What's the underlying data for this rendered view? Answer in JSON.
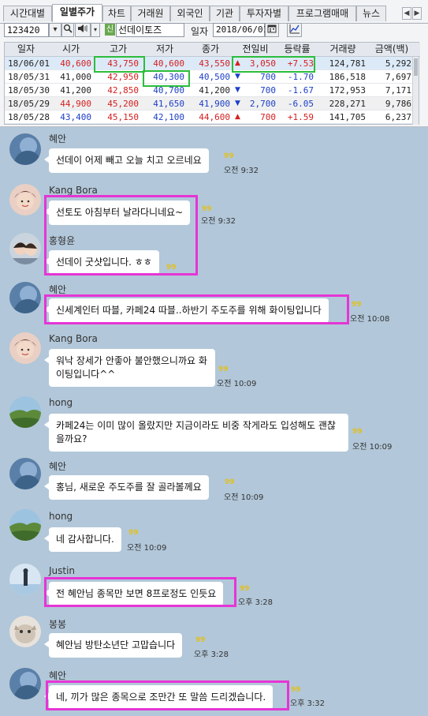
{
  "tabs": [
    "시간대별",
    "일별주가",
    "차트",
    "거래원",
    "외국인",
    "기관",
    "투자자별",
    "프로그램매매",
    "뉴스"
  ],
  "active_tab": "일별주가",
  "tab_arrows": [
    "◀",
    "▶"
  ],
  "toolbar": {
    "code": "123420",
    "dropdown_icon": "chevron-down-icon",
    "search_icon": "search-icon",
    "speaker_icon": "speaker-icon",
    "badge": "신",
    "stock_name": "선데이토즈",
    "date_label": "일자",
    "date_value": "2018/06/01",
    "calendar_icon": "calendar-icon",
    "chart_icon": "chart-icon"
  },
  "grid": {
    "headers": [
      "일자",
      "시가",
      "고가",
      "저가",
      "종가",
      "전일비",
      "등락률",
      "거래량",
      "금액(백)"
    ],
    "rows": [
      {
        "date": "18/06/01",
        "open": "40,600",
        "high": "43,750",
        "low": "40,600",
        "close": "43,550",
        "dir": "up",
        "change": "3,050",
        "rate": "+7.53",
        "volume": "124,781",
        "amount": "5,292"
      },
      {
        "date": "18/05/31",
        "open": "41,000",
        "high": "42,950",
        "low": "40,300",
        "close": "40,500",
        "dir": "down",
        "change": "700",
        "rate": "-1.70",
        "volume": "186,518",
        "amount": "7,697"
      },
      {
        "date": "18/05/30",
        "open": "41,200",
        "high": "42,850",
        "low": "40,700",
        "close": "41,200",
        "dir": "down",
        "change": "700",
        "rate": "-1.67",
        "volume": "172,953",
        "amount": "7,171"
      },
      {
        "date": "18/05/29",
        "open": "44,900",
        "high": "45,200",
        "low": "41,650",
        "close": "41,900",
        "dir": "down",
        "change": "2,700",
        "rate": "-6.05",
        "volume": "228,271",
        "amount": "9,786"
      },
      {
        "date": "18/05/28",
        "open": "43,400",
        "high": "45,150",
        "low": "42,100",
        "close": "44,600",
        "dir": "up",
        "change": "700",
        "rate": "+1.59",
        "volume": "141,705",
        "amount": "6,237"
      }
    ],
    "colors": {
      "up": "#d42020",
      "down": "#1c3fc8",
      "highlight_green": "#2bbd3c"
    }
  },
  "chat": {
    "highlight_color": "#e535d5",
    "messages": [
      {
        "sender": "혜안",
        "text": "선데이 어제 빼고 오늘 치고 오르네요",
        "unread": "99",
        "time": "오전 9:32"
      },
      {
        "sender": "Kang Bora",
        "text": "선토도 아침부터 날라다니네요~",
        "unread": "99",
        "time": "오전 9:32"
      },
      {
        "sender": "홍형윤",
        "text": "선데이 굿샷입니다. ㅎㅎ",
        "unread": "99",
        "time": ""
      },
      {
        "sender": "혜안",
        "text": "신세계인터 따블, 카페24 따블..하반기 주도주를 위해 화이팅입니다",
        "unread": "99",
        "time": "오전 10:08"
      },
      {
        "sender": "Kang Bora",
        "text": "워낙 장세가 안좋아 불안했으니까요 화이팅입니다^^",
        "unread": "99",
        "time": "오전 10:09"
      },
      {
        "sender": "hong",
        "text": "카페24는 이미 많이 올랐지만 지금이라도 비중 작게라도 입성해도 괜찮을까요?",
        "unread": "99",
        "time": "오전 10:09"
      },
      {
        "sender": "혜안",
        "text": "홍님, 새로운 주도주를 잘 골라볼께요",
        "unread": "99",
        "time": "오전 10:09"
      },
      {
        "sender": "hong",
        "text": "네 감사합니다.",
        "unread": "99",
        "time": "오전 10:09"
      },
      {
        "sender": "Justin",
        "text": "전 혜안님 종목만 보면 8프로정도 인듯요",
        "unread": "99",
        "time": "오후 3:28"
      },
      {
        "sender": "봉봉",
        "text": "혜안님 방탄소년단 고맙습니다",
        "unread": "99",
        "time": "오후 3:28"
      },
      {
        "sender": "혜안",
        "text": "네, 끼가 많은 종목으로 조만간 또 말씀 드리겠습니다.",
        "unread": "99",
        "time": "오후 3:32"
      }
    ]
  }
}
